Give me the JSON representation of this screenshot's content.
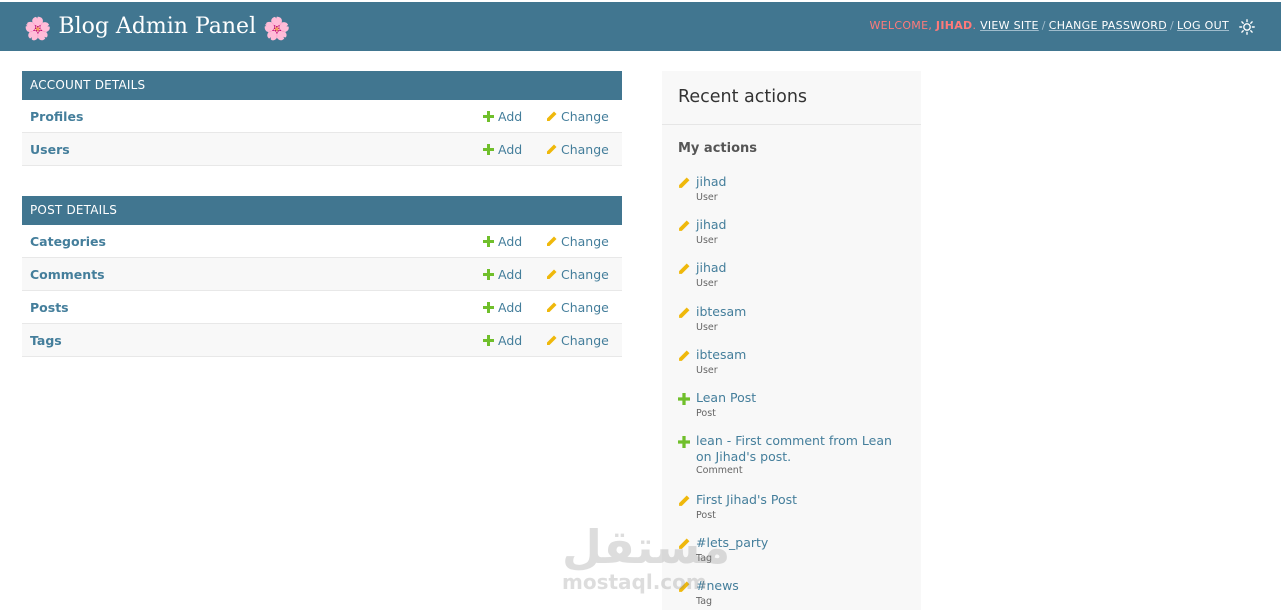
{
  "header": {
    "title": "Blog Admin Panel",
    "flower_glyph": "🌸",
    "welcome": "WELCOME,",
    "username": "JIHAD",
    "username_suffix": ".",
    "view_site": "VIEW SITE",
    "change_password": "CHANGE PASSWORD",
    "log_out": "LOG OUT",
    "separator": "/",
    "theme_icon": "sun-icon"
  },
  "modules": [
    {
      "title": "ACCOUNT DETAILS",
      "rows": [
        {
          "name": "Profiles",
          "add": "Add",
          "change": "Change"
        },
        {
          "name": "Users",
          "add": "Add",
          "change": "Change"
        }
      ]
    },
    {
      "title": "POST DETAILS",
      "rows": [
        {
          "name": "Categories",
          "add": "Add",
          "change": "Change"
        },
        {
          "name": "Comments",
          "add": "Add",
          "change": "Change"
        },
        {
          "name": "Posts",
          "add": "Add",
          "change": "Change"
        },
        {
          "name": "Tags",
          "add": "Add",
          "change": "Change"
        }
      ]
    }
  ],
  "recent": {
    "title": "Recent actions",
    "subtitle": "My actions",
    "actions": [
      {
        "icon": "pencil-icon",
        "label": "jihad",
        "type": "User"
      },
      {
        "icon": "pencil-icon",
        "label": "jihad",
        "type": "User"
      },
      {
        "icon": "pencil-icon",
        "label": "jihad",
        "type": "User"
      },
      {
        "icon": "pencil-icon",
        "label": "ibtesam",
        "type": "User"
      },
      {
        "icon": "pencil-icon",
        "label": "ibtesam",
        "type": "User"
      },
      {
        "icon": "plus-icon",
        "label": "Lean Post",
        "type": "Post"
      },
      {
        "icon": "plus-icon",
        "label": "lean - First comment from Lean on Jihad's post.",
        "type": "Comment"
      },
      {
        "icon": "pencil-icon",
        "label": "First Jihad's Post",
        "type": "Post"
      },
      {
        "icon": "pencil-icon",
        "label": "#lets_party",
        "type": "Tag"
      },
      {
        "icon": "pencil-icon",
        "label": "#news",
        "type": "Tag"
      }
    ]
  },
  "watermark": {
    "arabic": "مستقل",
    "latin": "mostaql.com"
  },
  "colors": {
    "header_bg": "#417690",
    "link": "#447e9b",
    "add_green": "#70bf2b",
    "change_yellow": "#efb80b",
    "username_red": "#ff7a7a"
  }
}
